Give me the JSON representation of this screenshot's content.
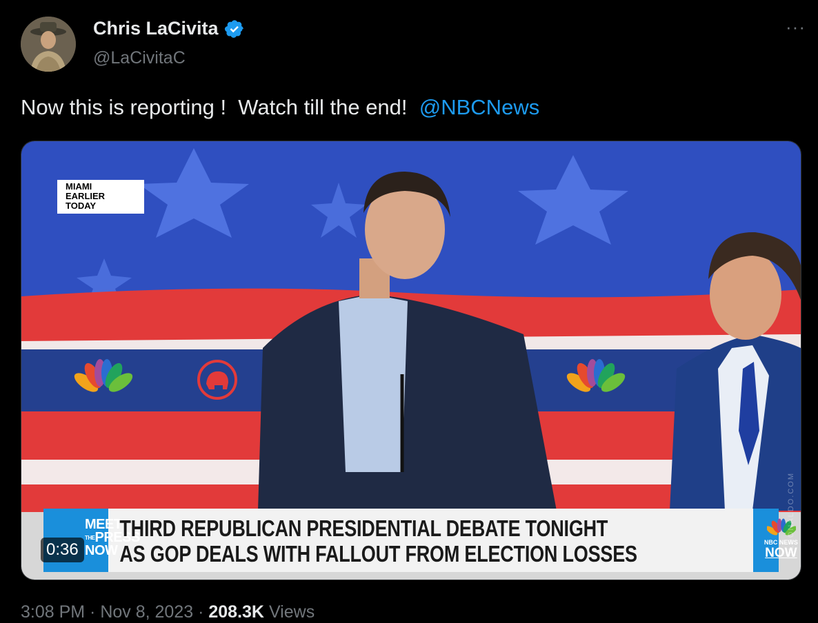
{
  "author": {
    "name": "Chris LaCivita",
    "handle": "@LaCivitaC",
    "verified": true
  },
  "more_menu": {
    "icon": "more-horizontal-icon",
    "label": "···"
  },
  "tweet": {
    "text": "Now this is reporting !  Watch till the end!  ",
    "mention": "@NBCNews"
  },
  "video": {
    "location_tag_line1": "MIAMI",
    "location_tag_line2": "EARLIER TODAY",
    "show_logo": {
      "line1": "MEET",
      "line2": "PRESS",
      "line3": "NOW",
      "small": "THE"
    },
    "headline_line1": "THIRD REPUBLICAN PRESIDENTIAL DEBATE TONIGHT",
    "headline_line2": "AS GOP DEALS WITH FALLOUT FROM ELECTION LOSSES",
    "network_logo_label": "NBC NEWS",
    "network_logo_now": "NOW",
    "duration": "0:36",
    "watermark": "ILDONALDO.COM",
    "colors": {
      "chyron_blue": "#1a8fdb",
      "stage_blue": "#2f4fc0",
      "stage_red": "#e23a3a"
    }
  },
  "meta": {
    "time": "3:08 PM",
    "date": "Nov 8, 2023",
    "views_count": "208.3K",
    "views_label": "Views"
  },
  "colors": {
    "link": "#1d9bf0",
    "secondary_text": "#71767b",
    "background": "#000000"
  }
}
